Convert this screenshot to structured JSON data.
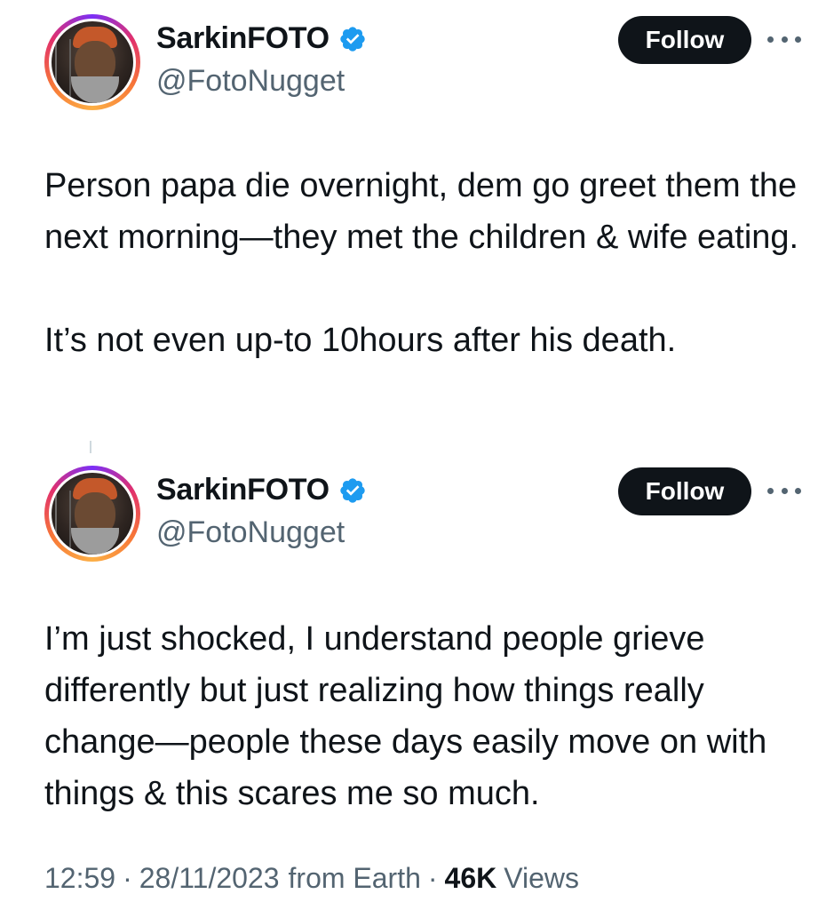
{
  "tweets": [
    {
      "author": {
        "name": "SarkinFOTO",
        "handle": "@FotoNugget",
        "verified": true
      },
      "follow_label": "Follow",
      "text": "Person papa die overnight, dem go greet them the next morning—they met the children & wife eating.\n\nIt’s not even up-to 10hours after his death."
    },
    {
      "author": {
        "name": "SarkinFOTO",
        "handle": "@FotoNugget",
        "verified": true
      },
      "follow_label": "Follow",
      "text": "I’m just shocked, I understand people grieve differently but just realizing how things really change—people these days easily move on with things & this scares me so much."
    }
  ],
  "meta": {
    "time": "12:59",
    "date": "28/11/2023",
    "source": "from Earth",
    "separator": "·",
    "views_count": "46K",
    "views_label": "Views"
  },
  "icons": {
    "verified": "verified-badge-icon",
    "more": "more-options-icon",
    "avatar": "avatar"
  },
  "colors": {
    "text_primary": "#0f1419",
    "text_secondary": "#536471",
    "verified_blue": "#1d9bf0",
    "follow_bg": "#0f1419",
    "follow_text": "#ffffff"
  }
}
